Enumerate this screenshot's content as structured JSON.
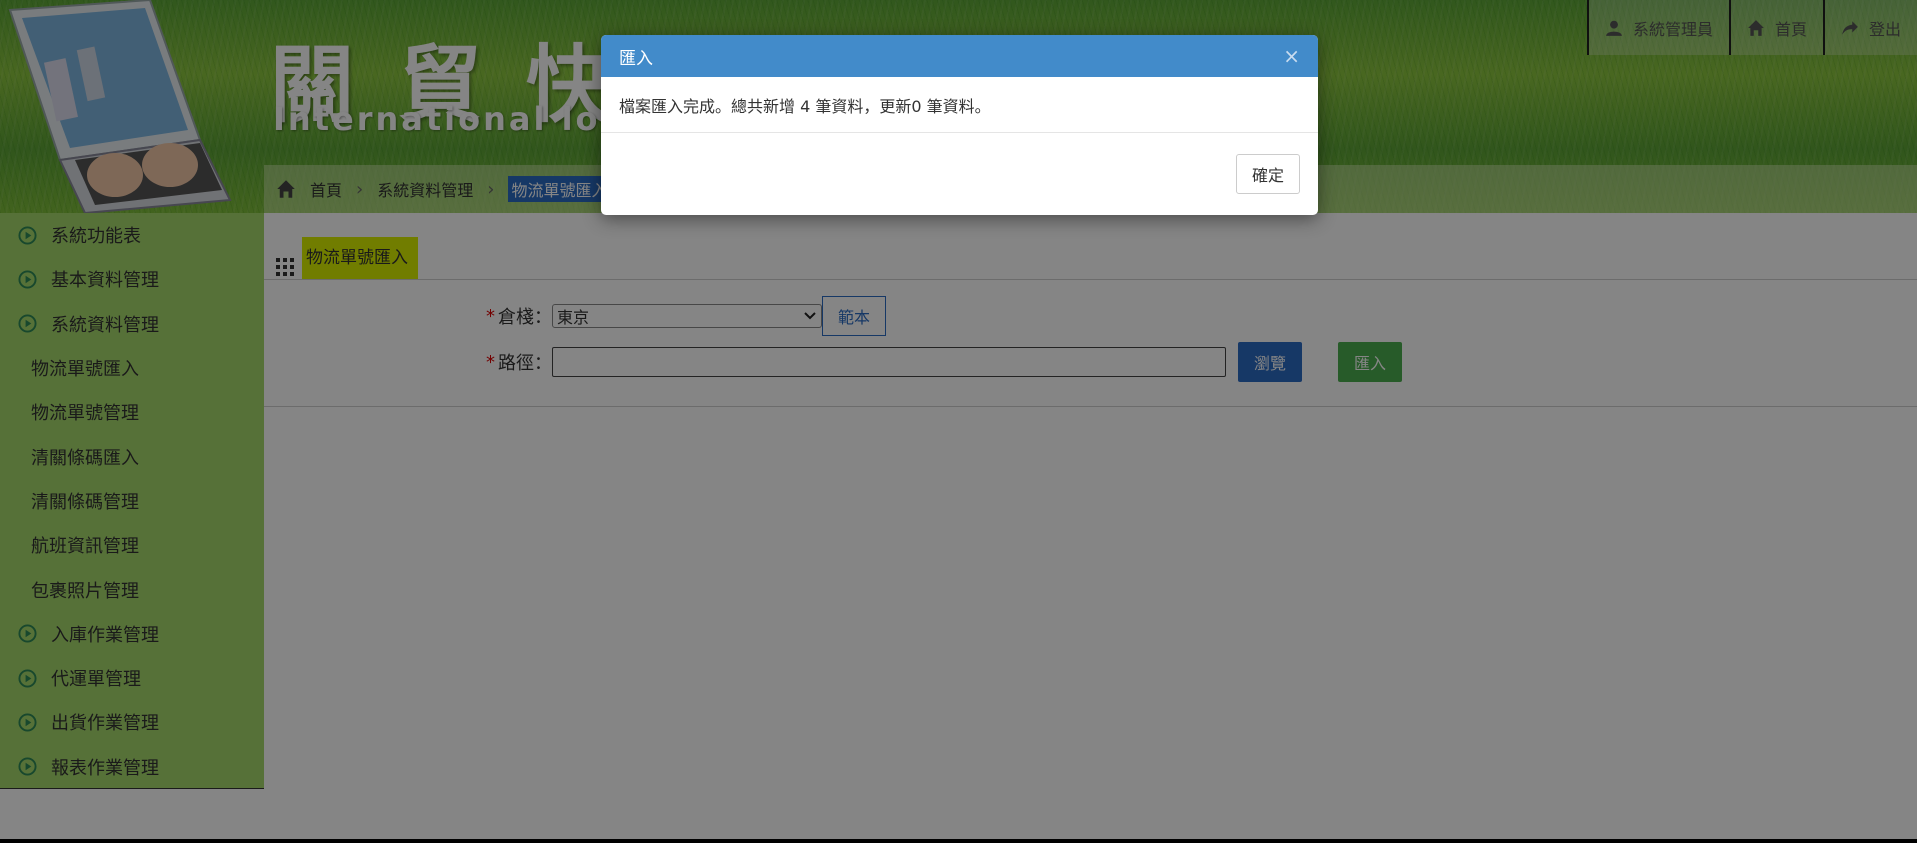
{
  "banner": {
    "title": "關貿快遞通",
    "subtitle": "International logistics"
  },
  "topnav": {
    "user": "系統管理員",
    "home": "首頁",
    "logout": "登出"
  },
  "breadcrumb": {
    "home": "首頁",
    "section": "系統資料管理",
    "current": "物流單號匯入"
  },
  "sidebar": {
    "items": [
      {
        "label": "系統功能表",
        "type": "top"
      },
      {
        "label": "基本資料管理",
        "type": "top"
      },
      {
        "label": "系統資料管理",
        "type": "top"
      },
      {
        "label": "物流單號匯入",
        "type": "sub"
      },
      {
        "label": "物流單號管理",
        "type": "sub"
      },
      {
        "label": "清關條碼匯入",
        "type": "sub"
      },
      {
        "label": "清關條碼管理",
        "type": "sub"
      },
      {
        "label": "航班資訊管理",
        "type": "sub"
      },
      {
        "label": "包裹照片管理",
        "type": "sub"
      },
      {
        "label": "入庫作業管理",
        "type": "top"
      },
      {
        "label": "代運單管理",
        "type": "top"
      },
      {
        "label": "出貨作業管理",
        "type": "top"
      },
      {
        "label": "報表作業管理",
        "type": "top"
      }
    ]
  },
  "panel": {
    "title": "物流單號匯入"
  },
  "form": {
    "warehouse_label": "倉棧：",
    "warehouse_value": "東京",
    "sample_button": "範本",
    "path_label": "路徑：",
    "path_value": "",
    "browse_button": "瀏覽",
    "import_button": "匯入"
  },
  "modal": {
    "title": "匯入",
    "close": "×",
    "message": "檔案匯入完成。總共新增 4 筆資料，更新0 筆資料。",
    "ok_button": "確定"
  },
  "colors": {
    "modal_header": "#428bca",
    "sidebar_bg": "#a6d86c",
    "panel_title_bg": "#d8f000",
    "browse_btn": "#2b6cc4",
    "import_btn": "#4caf50"
  }
}
